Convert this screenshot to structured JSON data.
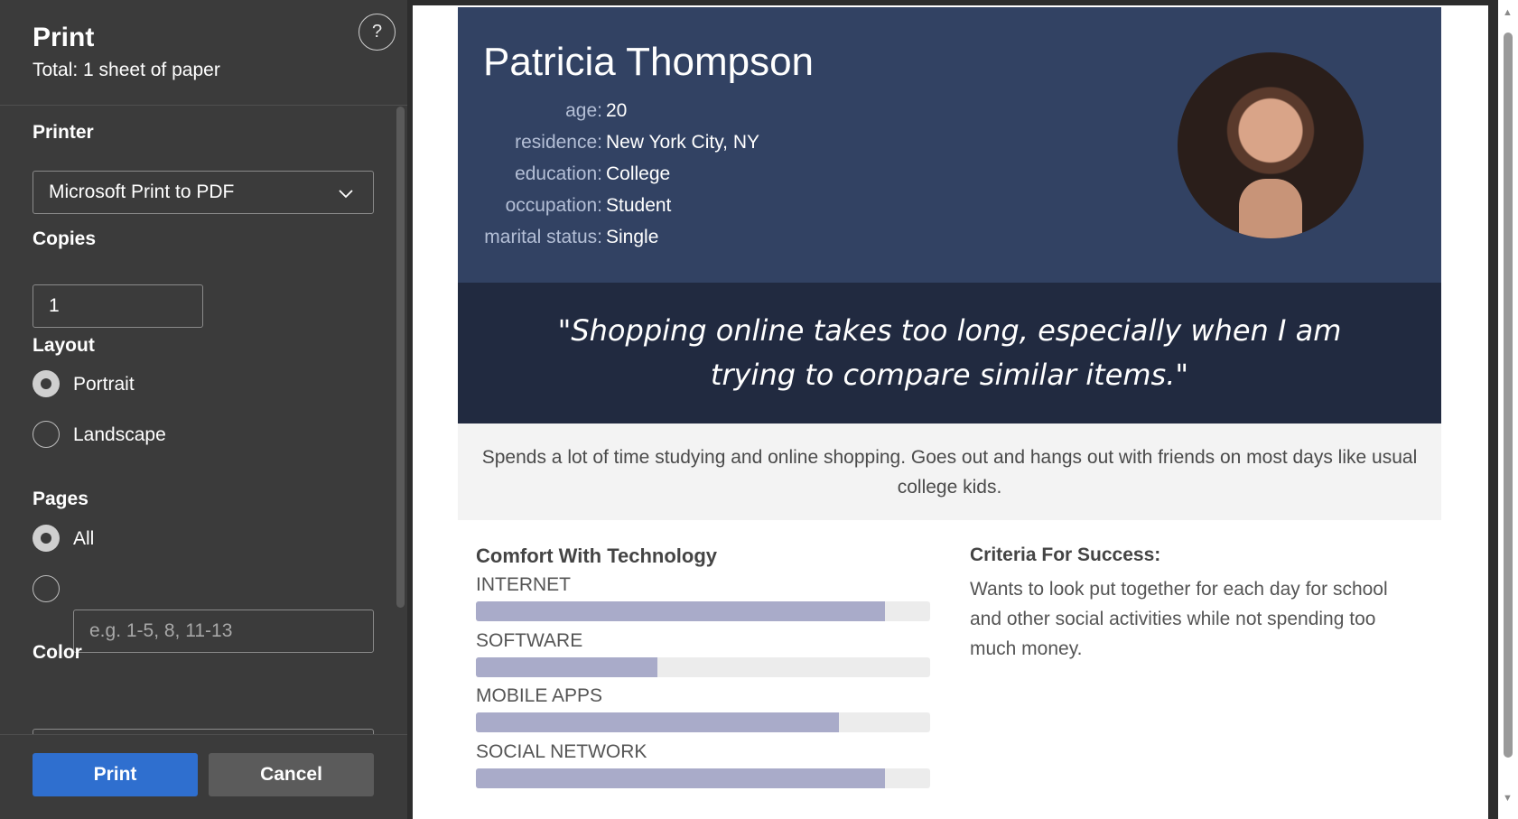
{
  "dialog": {
    "title": "Print",
    "subtitle": "Total: 1 sheet of paper",
    "help_symbol": "?"
  },
  "printer": {
    "label": "Printer",
    "value": "Microsoft Print to PDF"
  },
  "copies": {
    "label": "Copies",
    "value": "1"
  },
  "layout": {
    "label": "Layout",
    "options": [
      "Portrait",
      "Landscape"
    ],
    "selected": "Portrait"
  },
  "pages": {
    "label": "Pages",
    "all_label": "All",
    "custom_placeholder": "e.g. 1-5, 8, 11-13",
    "selected": "All"
  },
  "color": {
    "label": "Color"
  },
  "buttons": {
    "print": "Print",
    "cancel": "Cancel"
  },
  "persona": {
    "name": "Patricia Thompson",
    "attributes": [
      {
        "key": "age:",
        "value": "20"
      },
      {
        "key": "residence:",
        "value": "New York City, NY"
      },
      {
        "key": "education:",
        "value": "College"
      },
      {
        "key": "occupation:",
        "value": "Student"
      },
      {
        "key": "marital status:",
        "value": "Single"
      }
    ],
    "quote": "\"Shopping online takes too long, especially when I am trying to compare similar items.\"",
    "bio": "Spends a lot of time studying and online shopping. Goes out and hangs out with friends on most days like usual college kids.",
    "comfort_title": "Comfort With Technology",
    "tech": [
      {
        "label": "INTERNET",
        "level": 0.9
      },
      {
        "label": "SOFTWARE",
        "level": 0.4
      },
      {
        "label": "MOBILE APPS",
        "level": 0.8
      },
      {
        "label": "SOCIAL NETWORK",
        "level": 0.9
      }
    ],
    "criteria_title": "Criteria For Success:",
    "criteria_text": "Wants to look put together for each day for school and other social activities while not spending too much money."
  },
  "colors": {
    "header_bg": "#324263",
    "quote_bg": "#212a40",
    "bar_fill": "#a9abc9",
    "print_button": "#2f6fcf"
  }
}
